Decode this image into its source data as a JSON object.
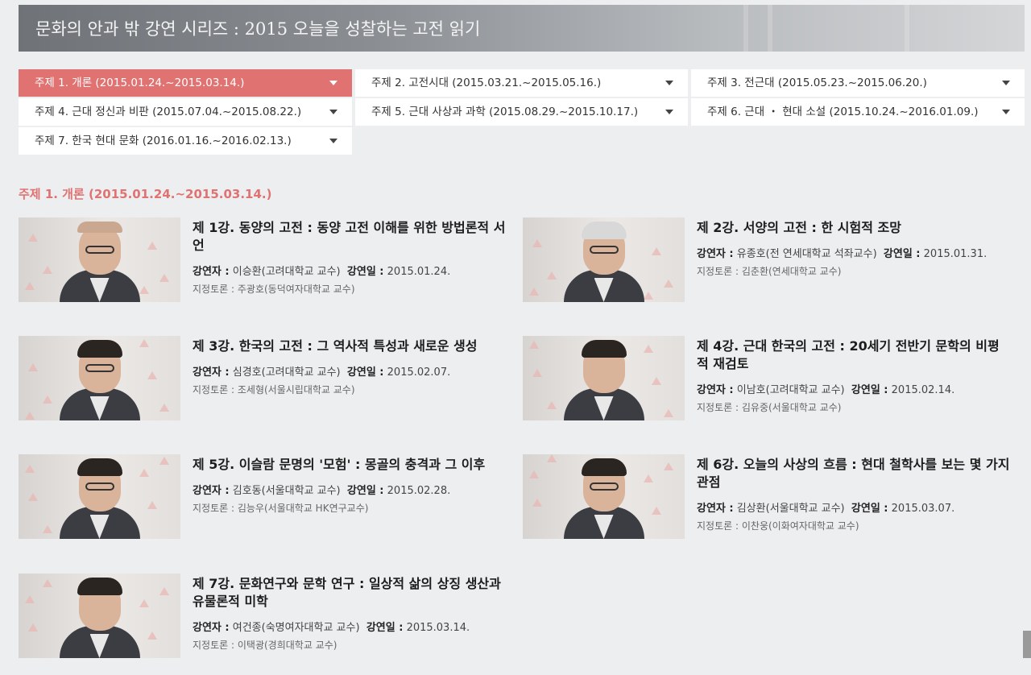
{
  "banner": {
    "title": "문화의 안과 밖 강연 시리즈 :  2015 오늘을 성찰하는 고전 읽기"
  },
  "tabs": [
    {
      "label": "주제 1. 개론 (2015.01.24.~2015.03.14.)",
      "active": true
    },
    {
      "label": "주제 2. 고전시대 (2015.03.21.~2015.05.16.)",
      "active": false
    },
    {
      "label": "주제 3. 전근대 (2015.05.23.~2015.06.20.)",
      "active": false
    },
    {
      "label": "주제 4. 근대 정신과 비판 (2015.07.04.~2015.08.22.)",
      "active": false
    },
    {
      "label": "주제 5. 근대 사상과 과학 (2015.08.29.~2015.10.17.)",
      "active": false
    },
    {
      "label": "주제 6. 근대 ・ 현대 소설 (2015.10.24.~2016.01.09.)",
      "active": false
    },
    {
      "label": "주제 7. 한국 현대 문화 (2016.01.16.~2016.02.13.)",
      "active": false
    }
  ],
  "section": {
    "heading": "주제 1. 개론 (2015.01.24.~2015.03.14.)"
  },
  "labels": {
    "lecturer": "강연자 :",
    "date": "강연일 :",
    "discussant": "지정토론 :"
  },
  "lectures": [
    {
      "title": "제 1강. 동양의 고전 : 동양 고전 이해를 위한 방법론적 서언",
      "lecturer": "이승환(고려대학교 교수)",
      "date": "2015.01.24.",
      "discussant": "주광호(동덕여자대학교 교수)"
    },
    {
      "title": "제 2강. 서양의 고전 : 한 시험적 조망",
      "lecturer": "유종호(전 연세대학교 석좌교수)",
      "date": "2015.01.31.",
      "discussant": "김춘환(연세대학교 교수)"
    },
    {
      "title": "제 3강. 한국의 고전 : 그 역사적 특성과 새로운 생성",
      "lecturer": "심경호(고려대학교 교수)",
      "date": "2015.02.07.",
      "discussant": "조세형(서울시립대학교 교수)"
    },
    {
      "title": "제 4강. 근대 한국의 고전 : 20세기 전반기 문학의 비평적 재검토",
      "lecturer": "이남호(고려대학교 교수)",
      "date": "2015.02.14.",
      "discussant": "김유중(서울대학교 교수)"
    },
    {
      "title": "제 5강. 이슬람 문명의 '모험' : 몽골의 충격과 그 이후",
      "lecturer": "김호동(서울대학교 교수)",
      "date": "2015.02.28.",
      "discussant": "김능우(서울대학교 HK연구교수)"
    },
    {
      "title": "제 6강. 오늘의 사상의 흐름 : 현대 철학사를 보는 몇 가지 관점",
      "lecturer": "김상환(서울대학교 교수)",
      "date": "2015.03.07.",
      "discussant": "이찬웅(이화여자대학교 교수)"
    },
    {
      "title": "제 7강. 문화연구와 문학 연구 : 일상적 삶의 상징 생산과 유물론적 미학",
      "lecturer": "여건종(숙명여자대학교 교수)",
      "date": "2015.03.14.",
      "discussant": "이택광(경희대학교 교수)"
    }
  ]
}
